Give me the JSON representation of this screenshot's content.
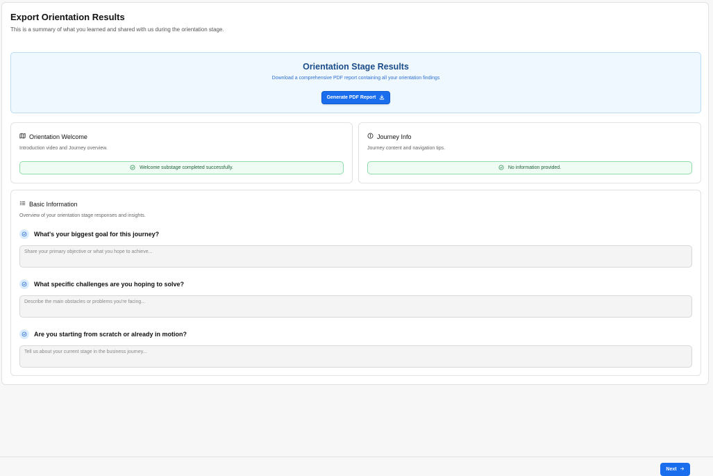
{
  "header": {
    "title": "Export Orientation Results",
    "subtitle": "This is a summary of what you learned and shared with us during the orientation stage."
  },
  "banner": {
    "title": "Orientation Stage Results",
    "subtitle": "Download a comprehensive PDF report containing all your orientation findings",
    "button_label": "Generate PDF Report",
    "button_icon": "download-icon"
  },
  "welcome_card": {
    "icon": "map-icon",
    "title": "Orientation Welcome",
    "description": "Introduction video and Journey overview.",
    "status": "Welcome substage completed successfully.",
    "status_icon": "check-circle-icon"
  },
  "journey_card": {
    "icon": "info-icon",
    "title": "Journey Info",
    "description": "Journey content and navigation tips.",
    "status": "No information provided.",
    "status_icon": "check-circle-icon"
  },
  "basic_info": {
    "icon": "list-icon",
    "title": "Basic Information",
    "description": "Overview of your orientation stage responses and insights.",
    "questions": [
      {
        "label": "What's your biggest goal for this journey?",
        "placeholder": "Share your primary objective or what you hope to achieve...",
        "value": ""
      },
      {
        "label": "What specific challenges are you hoping to solve?",
        "placeholder": "Describe the main obstacles or problems you're facing...",
        "value": ""
      },
      {
        "label": "Are you starting from scratch or already in motion?",
        "placeholder": "Tell us about your current stage in the business journey...",
        "value": ""
      }
    ]
  },
  "footer": {
    "next_label": "Next",
    "next_icon": "arrow-right-icon"
  },
  "colors": {
    "accent": "#1a6dec",
    "banner_bg": "#eff8ff",
    "banner_title": "#1b4c8a",
    "success_bg": "#eefcf3",
    "success_border": "#8fdcaa"
  }
}
